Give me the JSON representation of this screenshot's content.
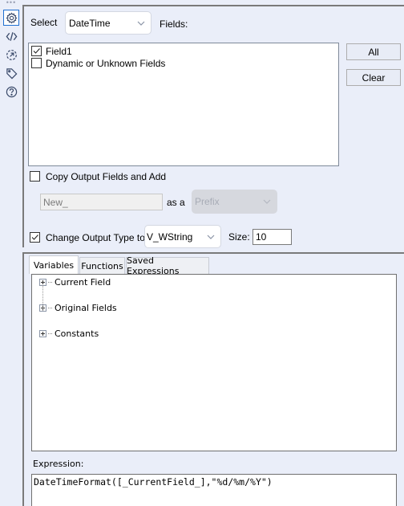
{
  "toolbar": {
    "items": [
      {
        "icon": "gear-icon",
        "active": true
      },
      {
        "icon": "code-icon",
        "active": false
      },
      {
        "icon": "target-arrow-icon",
        "active": false
      },
      {
        "icon": "tag-icon",
        "active": false
      },
      {
        "icon": "help-icon",
        "active": false
      }
    ]
  },
  "select": {
    "label": "Select",
    "value": "DateTime",
    "fields_label": "Fields:"
  },
  "fields": [
    {
      "label": "Field1",
      "checked": true
    },
    {
      "label": "Dynamic or Unknown Fields",
      "checked": false
    }
  ],
  "buttons": {
    "all": "All",
    "clear": "Clear"
  },
  "copy_output": {
    "label": "Copy Output Fields and Add",
    "checked": false,
    "prefix_value": "New_",
    "as_a_label": "as a",
    "position_value": "Prefix"
  },
  "change_type": {
    "label": "Change Output Type to",
    "checked": true,
    "type_value": "V_WString",
    "size_label": "Size:",
    "size_value": "10"
  },
  "tabs": [
    {
      "label": "Variables",
      "active": true
    },
    {
      "label": "Functions",
      "active": false
    },
    {
      "label": "Saved Expressions",
      "active": false
    }
  ],
  "tree": [
    {
      "label": "Current Field"
    },
    {
      "label": "Original Fields"
    },
    {
      "label": "Constants"
    }
  ],
  "expression": {
    "label": "Expression:",
    "value": "DateTimeFormat([_CurrentField_],\"%d/%m/%Y\")"
  },
  "colors": {
    "background": "#eaeef9",
    "accent": "#1f6fd1"
  }
}
